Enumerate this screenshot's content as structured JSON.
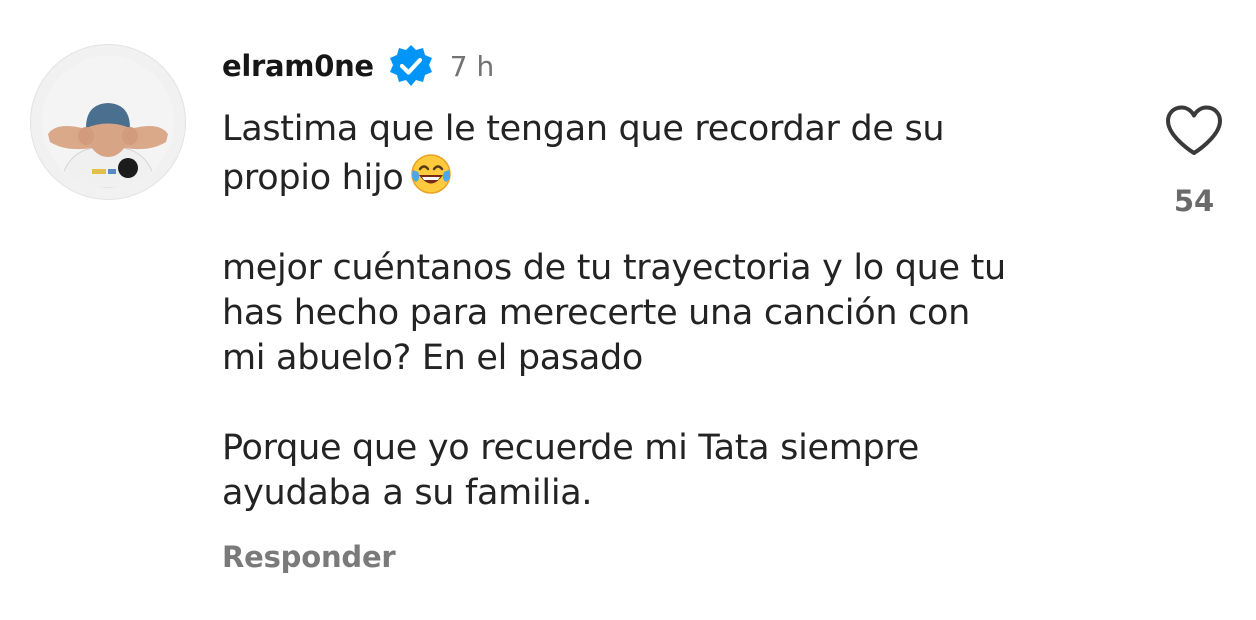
{
  "comment": {
    "username": "elram0ne",
    "verified": true,
    "timestamp": "7 h",
    "paragraphs": [
      [
        "Lastima que le tengan que recordar de su",
        "propio hijo"
      ],
      [
        "mejor cuéntanos de tu trayectoria y lo que tu",
        "has hecho para merecerte una canción con",
        "mi abuelo? En el pasado"
      ],
      [
        "Porque que yo recuerde mi Tata siempre",
        "ayudaba a su familia."
      ]
    ],
    "emoji": "face-with-tears-of-joy",
    "reply_label": "Responder",
    "like_count": "54"
  },
  "icons": {
    "verified": "verified-badge-icon",
    "like": "heart-outline-icon"
  },
  "colors": {
    "verified_badge": "#0095f6",
    "secondary_text": "#737373"
  }
}
